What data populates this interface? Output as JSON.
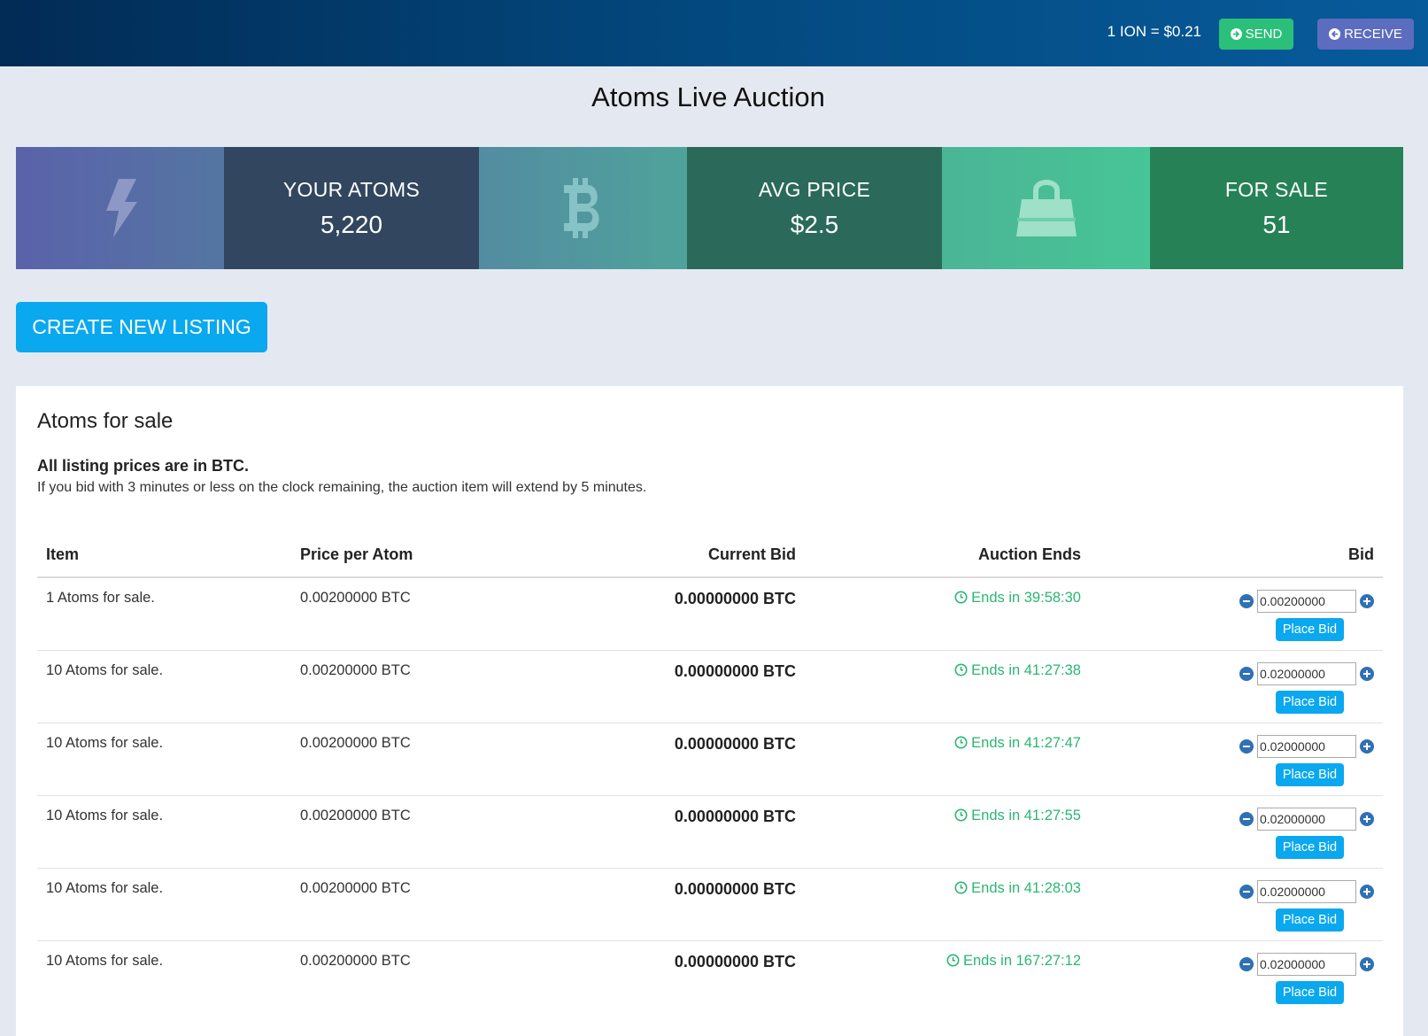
{
  "header": {
    "rate": "1 ION = $0.21",
    "send_label": "SEND",
    "receive_label": "RECEIVE"
  },
  "page_title": "Atoms Live Auction",
  "stats": {
    "atoms_label": "YOUR ATOMS",
    "atoms_value": "5,220",
    "avg_label": "AVG PRICE",
    "avg_value": "$2.5",
    "sale_label": "FOR SALE",
    "sale_value": "51"
  },
  "create_label": "CREATE NEW LISTING",
  "panel": {
    "title": "Atoms for sale",
    "note_bold": "All listing prices are in BTC.",
    "note": "If you bid with 3 minutes or less on the clock remaining, the auction item will extend by 5 minutes."
  },
  "table": {
    "columns": [
      "Item",
      "Price per Atom",
      "Current Bid",
      "Auction Ends",
      "Bid"
    ],
    "place_bid_label": "Place Bid",
    "rows": [
      {
        "item": "1 Atoms for sale.",
        "price": "0.00200000 BTC",
        "current_bid": "0.00000000 BTC",
        "ends": "Ends in 39:58:30",
        "bid_value": "0.00200000"
      },
      {
        "item": "10 Atoms for sale.",
        "price": "0.00200000 BTC",
        "current_bid": "0.00000000 BTC",
        "ends": "Ends in 41:27:38",
        "bid_value": "0.02000000"
      },
      {
        "item": "10 Atoms for sale.",
        "price": "0.00200000 BTC",
        "current_bid": "0.00000000 BTC",
        "ends": "Ends in 41:27:47",
        "bid_value": "0.02000000"
      },
      {
        "item": "10 Atoms for sale.",
        "price": "0.00200000 BTC",
        "current_bid": "0.00000000 BTC",
        "ends": "Ends in 41:27:55",
        "bid_value": "0.02000000"
      },
      {
        "item": "10 Atoms for sale.",
        "price": "0.00200000 BTC",
        "current_bid": "0.00000000 BTC",
        "ends": "Ends in 41:28:03",
        "bid_value": "0.02000000"
      },
      {
        "item": "10 Atoms for sale.",
        "price": "0.00200000 BTC",
        "current_bid": "0.00000000 BTC",
        "ends": "Ends in 167:27:12",
        "bid_value": "0.02000000"
      }
    ]
  },
  "colors": {
    "accent": "#0aa8ee",
    "send": "#2bc07a",
    "receive": "#5c6cbf",
    "ends_text": "#2bb673"
  },
  "icons": {
    "stat1": "lightning-bolt-icon",
    "stat2": "bitcoin-icon",
    "stat3": "shopping-bag-icon",
    "clock": "clock-icon",
    "minus": "minus-circle-icon",
    "plus": "plus-circle-icon"
  }
}
